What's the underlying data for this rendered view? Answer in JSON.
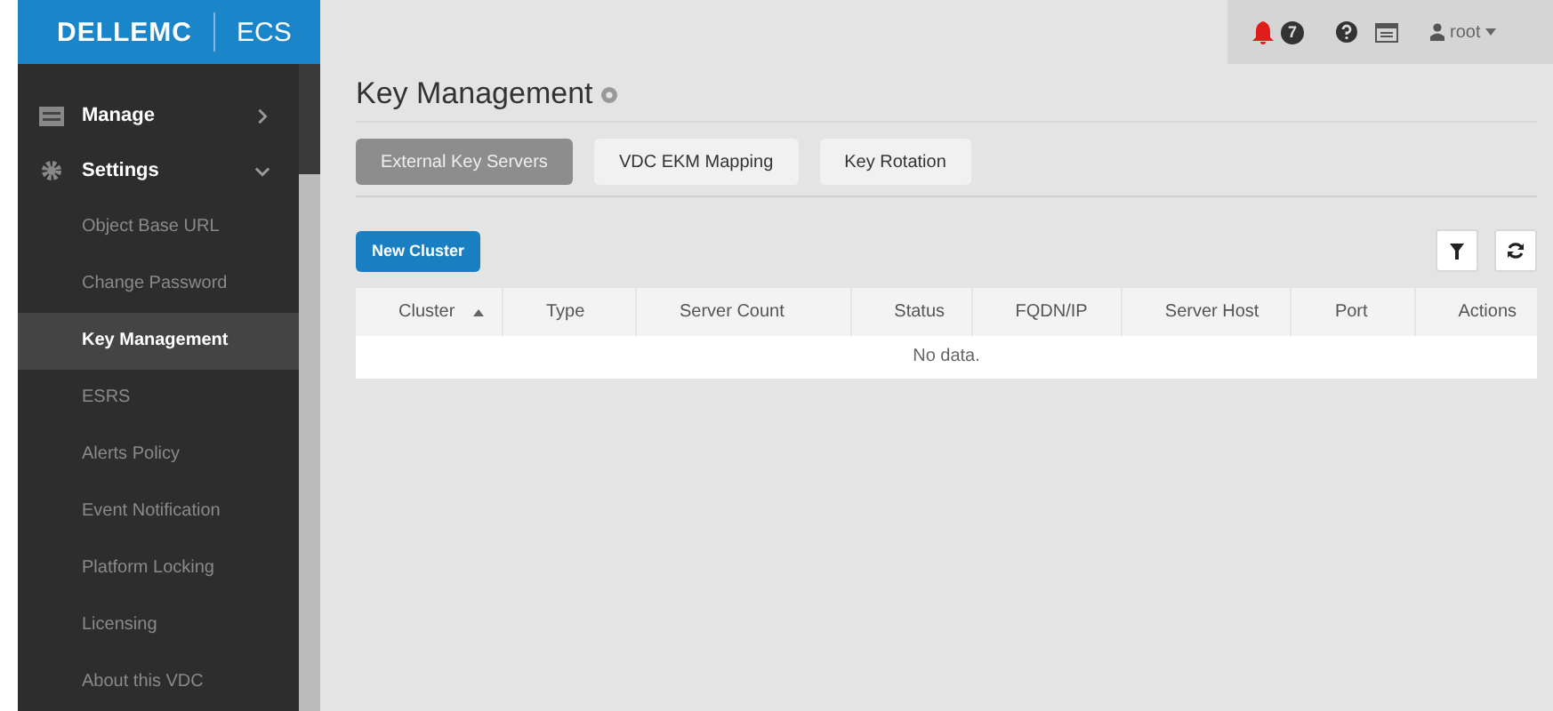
{
  "brand": {
    "logo": "DELLEMC",
    "product": "ECS"
  },
  "sidebar": {
    "items": [
      {
        "label": "Manage",
        "kind": "section",
        "expanded": false
      },
      {
        "label": "Settings",
        "kind": "settings",
        "expanded": true,
        "children": [
          {
            "label": "Object Base URL",
            "selected": false
          },
          {
            "label": "Change Password",
            "selected": false
          },
          {
            "label": "Key Management",
            "selected": true
          },
          {
            "label": "ESRS",
            "selected": false
          },
          {
            "label": "Alerts Policy",
            "selected": false
          },
          {
            "label": "Event Notification",
            "selected": false
          },
          {
            "label": "Platform Locking",
            "selected": false
          },
          {
            "label": "Licensing",
            "selected": false
          },
          {
            "label": "About this VDC",
            "selected": false
          }
        ]
      }
    ]
  },
  "topbar": {
    "alert_count": "7",
    "user": "root"
  },
  "page": {
    "title": "Key Management"
  },
  "tabs": [
    {
      "label": "External Key Servers",
      "selected": true
    },
    {
      "label": "VDC EKM Mapping",
      "selected": false
    },
    {
      "label": "Key Rotation",
      "selected": false
    }
  ],
  "new_button": "New Cluster",
  "table": {
    "columns": [
      {
        "label": "Cluster",
        "sorted": true
      },
      {
        "label": "Type",
        "sorted": false
      },
      {
        "label": "Server Count",
        "sorted": false
      },
      {
        "label": "Status",
        "sorted": false
      },
      {
        "label": "FQDN/IP",
        "sorted": false
      },
      {
        "label": "Server Host",
        "sorted": false
      },
      {
        "label": "Port",
        "sorted": false
      },
      {
        "label": "Actions",
        "sorted": false
      }
    ],
    "empty": "No data."
  }
}
